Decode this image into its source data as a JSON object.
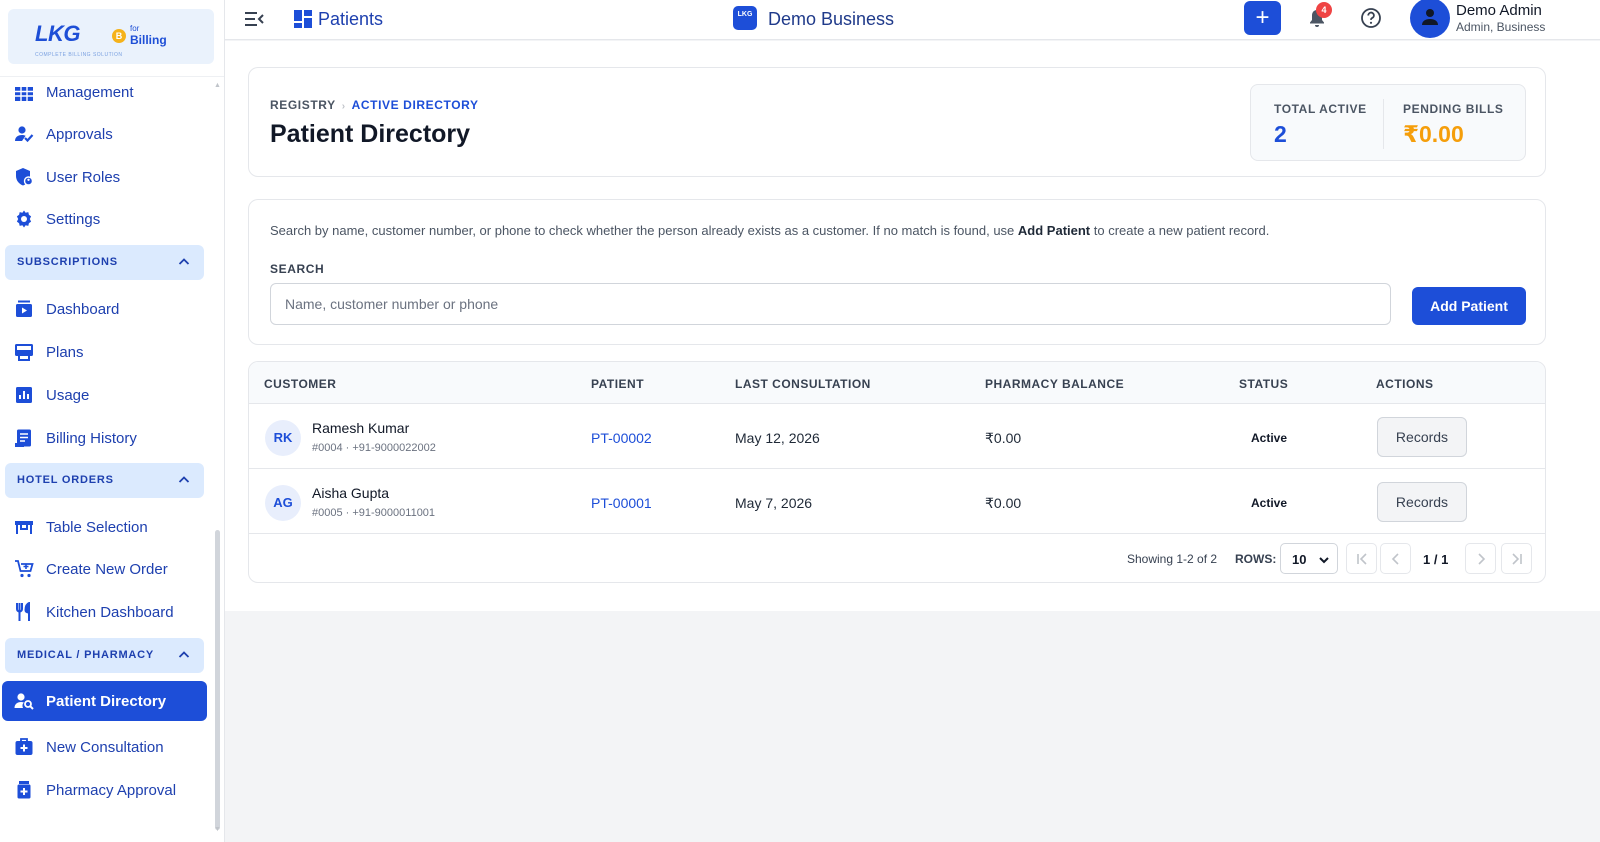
{
  "logo": {
    "main": "LKG",
    "coin": "B",
    "for": "for",
    "billing": "Billing",
    "tagline": "COMPLETE BILLING SOLUTION"
  },
  "sidebar": {
    "items_top": [
      {
        "label": "Management",
        "icon": "grid-table-icon"
      },
      {
        "label": "Approvals",
        "icon": "user-check-icon"
      },
      {
        "label": "User Roles",
        "icon": "shield-user-icon"
      },
      {
        "label": "Settings",
        "icon": "gear-icon"
      }
    ],
    "sections": [
      {
        "title": "SUBSCRIPTIONS",
        "items": [
          {
            "label": "Dashboard",
            "icon": "dashboard-icon"
          },
          {
            "label": "Plans",
            "icon": "plans-icon"
          },
          {
            "label": "Usage",
            "icon": "usage-chart-icon"
          },
          {
            "label": "Billing History",
            "icon": "receipt-icon"
          }
        ]
      },
      {
        "title": "HOTEL ORDERS",
        "items": [
          {
            "label": "Table Selection",
            "icon": "table-icon"
          },
          {
            "label": "Create New Order",
            "icon": "cart-plus-icon"
          },
          {
            "label": "Kitchen Dashboard",
            "icon": "fork-knife-icon"
          }
        ]
      },
      {
        "title": "MEDICAL / PHARMACY",
        "items": [
          {
            "label": "Patient Directory",
            "icon": "user-search-icon",
            "active": true
          },
          {
            "label": "New Consultation",
            "icon": "medical-kit-icon"
          },
          {
            "label": "Pharmacy Approval",
            "icon": "pharmacy-icon"
          }
        ]
      }
    ]
  },
  "topbar": {
    "page_title": "Patients",
    "business_logo": "LKG",
    "business_name": "Demo Business",
    "notifications_count": "4",
    "user_name": "Demo Admin",
    "user_role": "Admin, Business"
  },
  "header": {
    "crumb_1": "REGISTRY",
    "crumb_sep": "›",
    "crumb_2": "ACTIVE DIRECTORY",
    "title": "Patient Directory",
    "total_active_label": "TOTAL ACTIVE",
    "total_active_value": "2",
    "pending_bills_label": "PENDING BILLS",
    "pending_bills_value": "₹0.00"
  },
  "search": {
    "help_pre": "Search by name, customer number, or phone to check whether the person already exists as a customer. If no match is found, use ",
    "help_bold": "Add Patient",
    "help_post": " to create a new patient record.",
    "label": "SEARCH",
    "placeholder": "Name, customer number or phone",
    "add_button": "Add Patient"
  },
  "table": {
    "columns": [
      "CUSTOMER",
      "PATIENT",
      "LAST CONSULTATION",
      "PHARMACY BALANCE",
      "STATUS",
      "ACTIONS"
    ],
    "rows": [
      {
        "initials": "RK",
        "name": "Ramesh Kumar",
        "sub": "#0004 · +91-9000022002",
        "patient_id": "PT-00002",
        "last_consultation": "May 12, 2026",
        "balance": "₹0.00",
        "status": "Active",
        "action": "Records"
      },
      {
        "initials": "AG",
        "name": "Aisha Gupta",
        "sub": "#0005 · +91-9000011001",
        "patient_id": "PT-00001",
        "last_consultation": "May 7, 2026",
        "balance": "₹0.00",
        "status": "Active",
        "action": "Records"
      }
    ]
  },
  "pagination": {
    "showing": "Showing 1-2 of 2",
    "rows_label": "ROWS:",
    "rows_value": "10",
    "page": "1 / 1"
  },
  "colors": {
    "primary": "#1d4ed8",
    "pending": "#f59e0b",
    "badge": "#ef4444"
  }
}
